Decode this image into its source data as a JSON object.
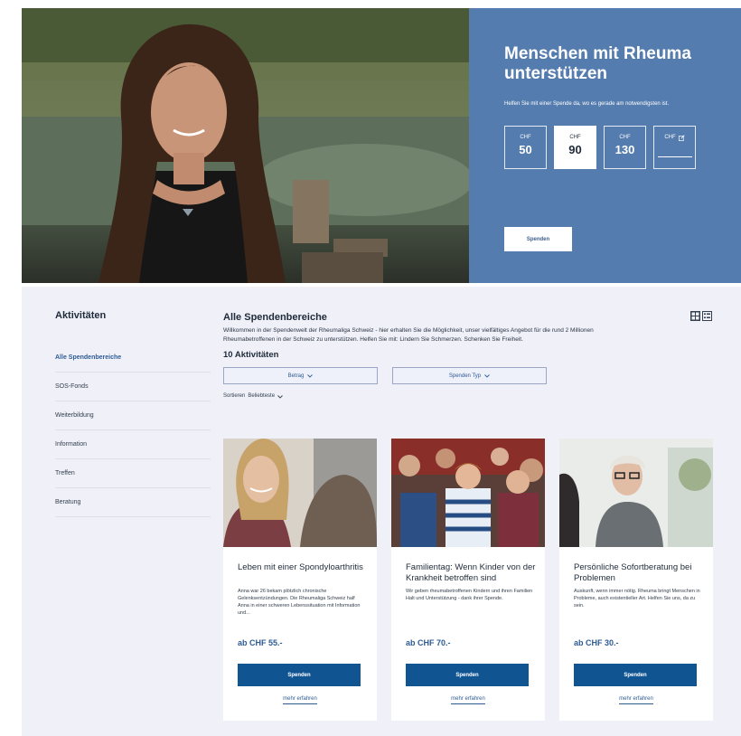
{
  "hero": {
    "title": "Menschen mit Rheuma unterstützen",
    "subtitle": "Helfen Sie mit einer Spende da, wo es gerade am notwendigsten ist.",
    "currency": "CHF",
    "amounts": [
      {
        "value": "50",
        "selected": false
      },
      {
        "value": "90",
        "selected": true
      },
      {
        "value": "130",
        "selected": false
      }
    ],
    "custom_icon": "edit-icon",
    "donate_label": "Spenden",
    "panel_color": "#557cae"
  },
  "sidebar": {
    "title": "Aktivitäten",
    "items": [
      {
        "label": "Alle Spendenbereiche",
        "active": true
      },
      {
        "label": "SOS-Fonds",
        "active": false
      },
      {
        "label": "Weiterbildung",
        "active": false
      },
      {
        "label": "Information",
        "active": false
      },
      {
        "label": "Treffen",
        "active": false
      },
      {
        "label": "Beratung",
        "active": false
      }
    ]
  },
  "main": {
    "title": "Alle Spendenbereiche",
    "description": "Willkommen in der Spendenwelt der Rheumaliga Schweiz - hier erhalten Sie die Möglichkeit, unser vielfältiges Angebot für die rund 2 Millionen Rheumabetroffenen in der Schweiz zu unterstützen. Helfen Sie mit: Lindern Sie Schmerzen. Schenken Sie Freiheit.",
    "count": "10 Aktivitäten",
    "filters": [
      {
        "label": "Betrag"
      },
      {
        "label": "Spenden Typ"
      }
    ],
    "sort_label": "Sortieren",
    "sort_value": "Beliebteste",
    "view_icon": "grid-view-icon"
  },
  "cards": [
    {
      "title": "Leben mit einer Spondyloarthritis",
      "text": "Anna war 26 bekam plötzlich chronische Gelenksentzündungen. Die Rheumaliga Schweiz half Anna in einer schweren Lebenssituation mit Information und...",
      "price": "ab CHF 55.-",
      "button": "Spenden",
      "link": "mehr erfahren"
    },
    {
      "title": "Familientag: Wenn Kinder von der Krankheit betroffen sind",
      "text": "Wir geben rheumabetroffenen Kindern und ihren Familien Halt und Unterstützung - dank ihrer Spende.",
      "price": "ab CHF 70.-",
      "button": "Spenden",
      "link": "mehr erfahren"
    },
    {
      "title": "Persönliche Sofortberatung bei Problemen",
      "text": "Auskunft, wenn immer nötig. Rheuma bringt Menschen in Probleme, auch existentieller Art. Helfen Sie uns, da zu sein.",
      "price": "ab CHF 30.-",
      "button": "Spenden",
      "link": "mehr erfahren"
    }
  ],
  "colors": {
    "accent": "#105491",
    "link": "#2e5b94",
    "background": "#eff0f8"
  }
}
